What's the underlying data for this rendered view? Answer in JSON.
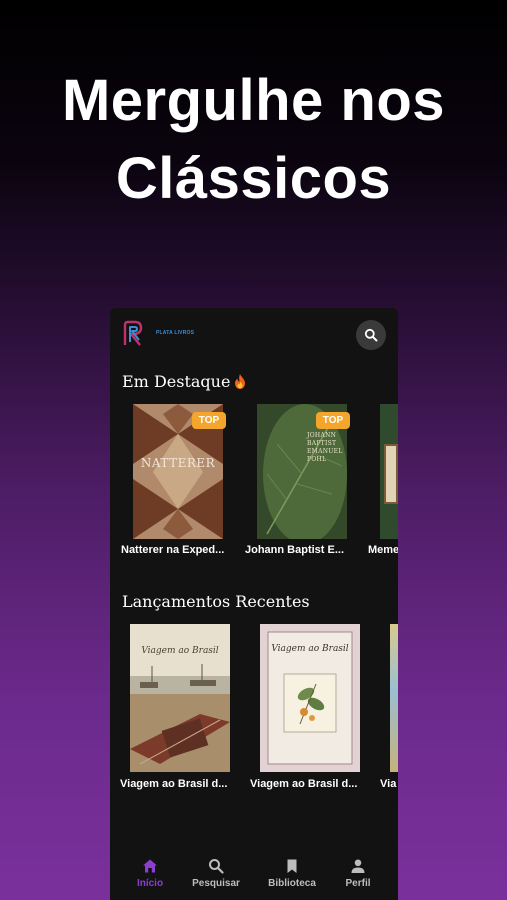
{
  "headline": {
    "line1": "Mergulhe nos",
    "line2": "Clássicos"
  },
  "app": {
    "logo_text": "PLATA LIVROS"
  },
  "featured": {
    "title": "Em Destaque",
    "badge": "TOP",
    "items": [
      {
        "title": "Natterer na Exped...",
        "cover_text": "NATTERER",
        "has_badge": true
      },
      {
        "title": "Johann Baptist E...",
        "cover_text": "JOHANN BAPTIST EMANUEL POHL",
        "has_badge": true
      },
      {
        "title": "Meme",
        "cover_text": "",
        "has_badge": false
      }
    ]
  },
  "recent": {
    "title": "Lançamentos Recentes",
    "items": [
      {
        "title": "Viagem ao Brasil d...",
        "cover_text": "Viagem ao Brasil"
      },
      {
        "title": "Viagem ao Brasil d...",
        "cover_text": "Viagem ao Brasil"
      },
      {
        "title": "Via",
        "cover_text": ""
      }
    ]
  },
  "nav": [
    {
      "label": "Início",
      "icon": "home-icon",
      "active": true
    },
    {
      "label": "Pesquisar",
      "icon": "search-icon",
      "active": false
    },
    {
      "label": "Biblioteca",
      "icon": "bookmark-icon",
      "active": false
    },
    {
      "label": "Perfil",
      "icon": "person-icon",
      "active": false
    }
  ],
  "colors": {
    "accent": "#8a3fd0",
    "badge": "#f4a52b",
    "surface": "#121212"
  }
}
